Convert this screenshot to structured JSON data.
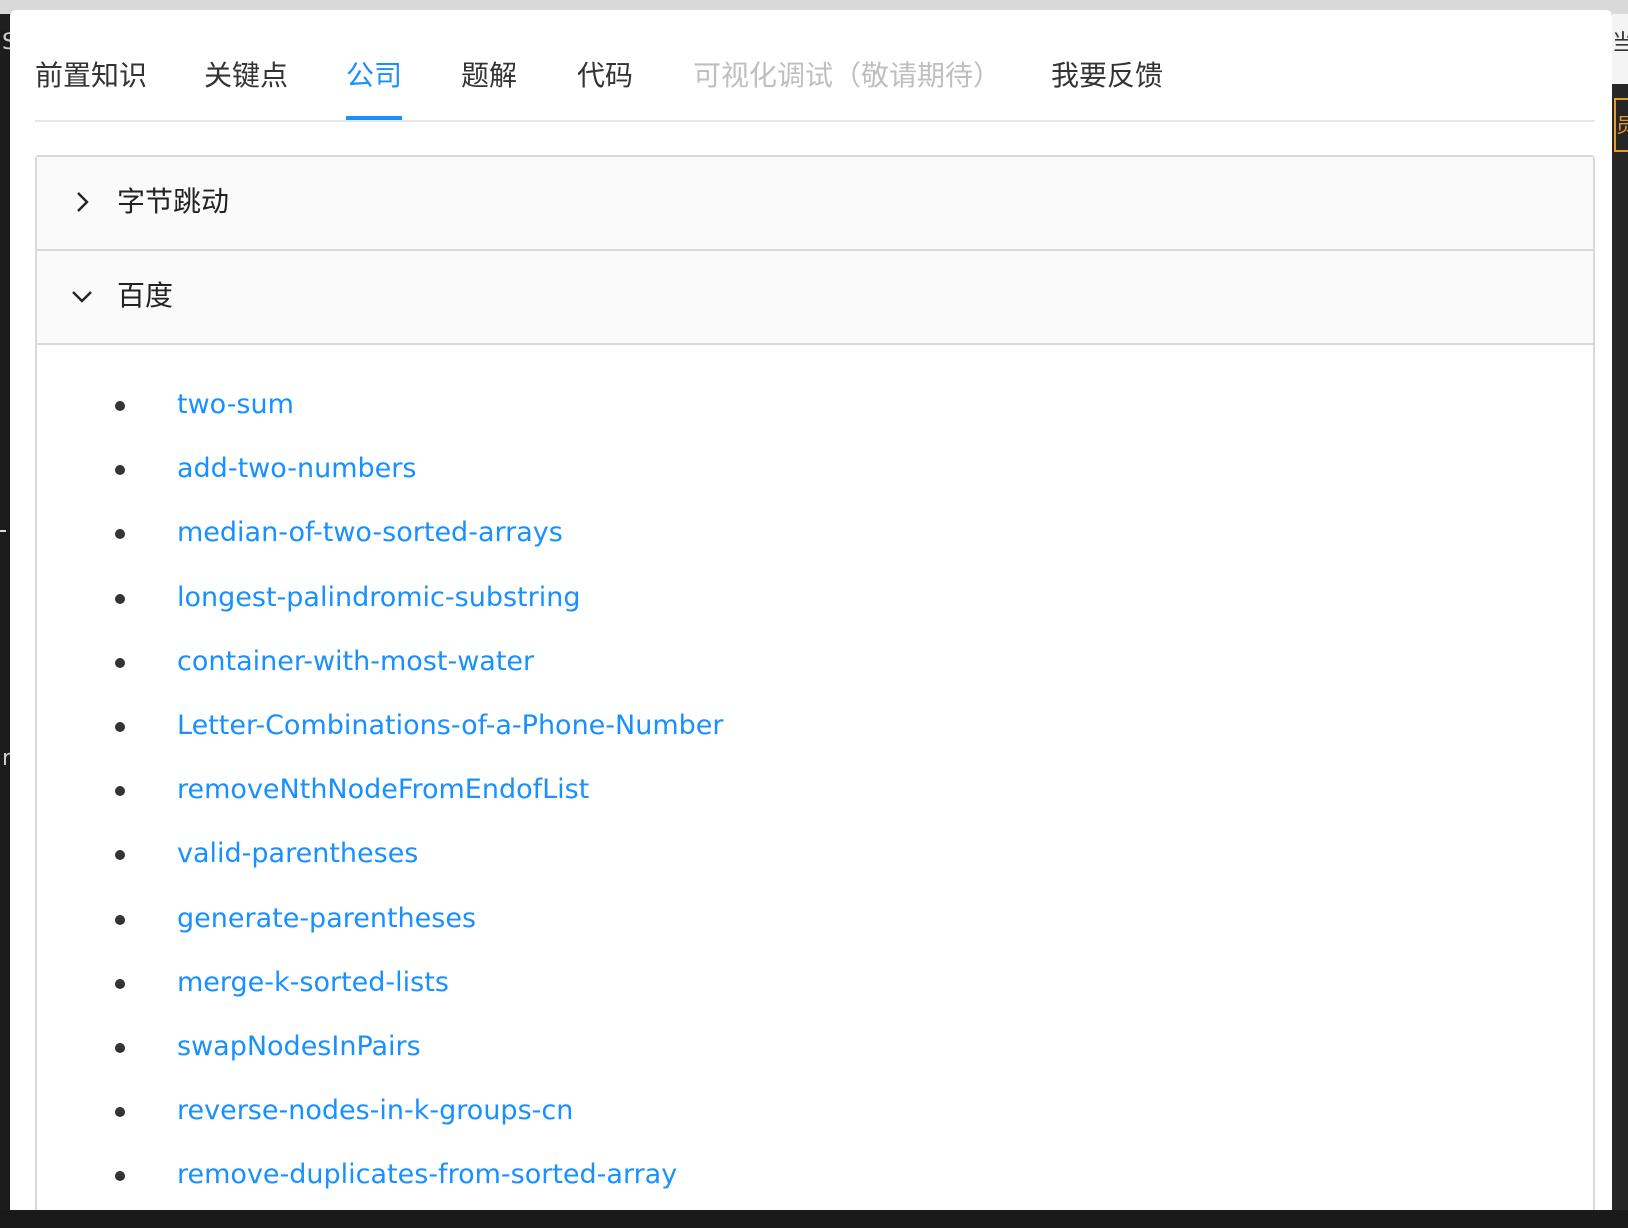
{
  "tabs": [
    {
      "label": "前置知识",
      "state": "normal"
    },
    {
      "label": "关键点",
      "state": "normal"
    },
    {
      "label": "公司",
      "state": "active"
    },
    {
      "label": "题解",
      "state": "normal"
    },
    {
      "label": "代码",
      "state": "normal"
    },
    {
      "label": "可视化调试（敬请期待）",
      "state": "disabled"
    },
    {
      "label": "我要反馈",
      "state": "normal"
    }
  ],
  "companies": [
    {
      "name": "字节跳动",
      "expanded": false,
      "icon": "chevron-right-icon"
    },
    {
      "name": "百度",
      "expanded": true,
      "icon": "chevron-down-icon"
    }
  ],
  "problems": [
    "two-sum",
    "add-two-numbers",
    "median-of-two-sorted-arrays",
    "longest-palindromic-substring",
    "container-with-most-water",
    "Letter-Combinations-of-a-Phone-Number",
    "removeNthNodeFromEndofList",
    "valid-parentheses",
    "generate-parentheses",
    "merge-k-sorted-lists",
    "swapNodesInPairs",
    "reverse-nodes-in-k-groups-cn",
    "remove-duplicates-from-sorted-array"
  ],
  "colors": {
    "accent": "#1890ff",
    "disabled": "#bfbfbf",
    "text": "#333333"
  }
}
